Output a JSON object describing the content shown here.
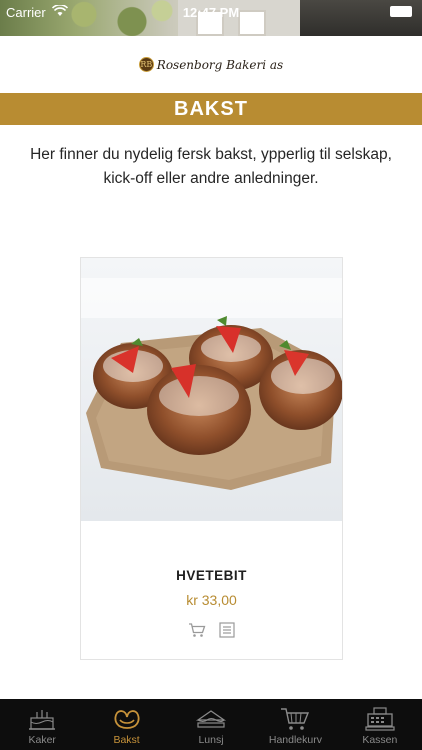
{
  "status_bar": {
    "carrier": "Carrier",
    "time": "12:47 PM"
  },
  "header": {
    "logo_mark": "RB",
    "brand": "Rosenborg Bakeri as"
  },
  "section": {
    "title": "BAKST",
    "intro": "Her finner du nydelig fersk bakst, ypperlig til selskap, kick-off eller andre anledninger."
  },
  "products": [
    {
      "name": "HVETEBIT",
      "price": "kr 33,00",
      "image_icon": "pastry-photo",
      "actions": [
        {
          "icon": "cart-icon",
          "label": "add-to-cart"
        },
        {
          "icon": "details-icon",
          "label": "details"
        }
      ]
    }
  ],
  "tabs": [
    {
      "label": "Kaker",
      "icon": "cake-icon",
      "active": false
    },
    {
      "label": "Bakst",
      "icon": "pretzel-icon",
      "active": true
    },
    {
      "label": "Lunsj",
      "icon": "sandwich-icon",
      "active": false
    },
    {
      "label": "Handlekurv",
      "icon": "cart-icon",
      "active": false
    },
    {
      "label": "Kassen",
      "icon": "register-icon",
      "active": false
    }
  ],
  "colors": {
    "accent": "#b88c32",
    "tab_bar": "#0d0d0d",
    "tab_active": "#c6923a",
    "tab_inactive": "#8a8a8a"
  }
}
